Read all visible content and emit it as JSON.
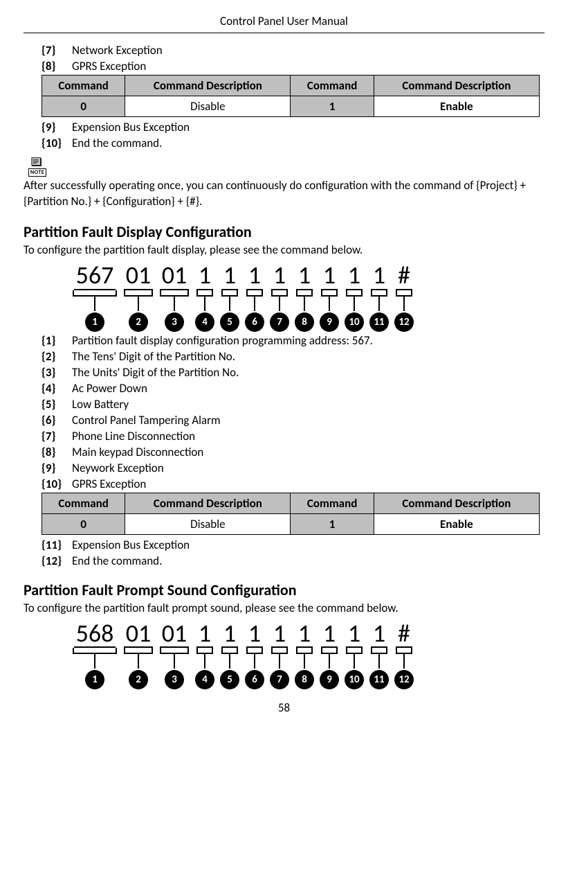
{
  "header_title": "Control Panel User Manual",
  "top_items": [
    {
      "n": "{7}",
      "t": "Network Exception"
    },
    {
      "n": "{8}",
      "t": "GPRS Exception"
    }
  ],
  "table1": {
    "h": [
      "Command",
      "Command Description",
      "Command",
      "Command Description"
    ],
    "r": [
      "0",
      "Disable",
      "1",
      "Enable"
    ]
  },
  "post_table1_items": [
    {
      "n": "{9}",
      "t": "Expension Bus Exception"
    },
    {
      "n": "{10}",
      "t": "End the command."
    }
  ],
  "note_label": "NOTE",
  "note_text": "After successfully operating once, you can continuously do configuration with the command of {Project} + {Partition No.} + {Configuration} + {#}.",
  "section1": {
    "heading": "Partition Fault Display Configuration",
    "intro": "To configure the partition fault display, please see the command below.",
    "digits": [
      "567",
      "01",
      "01",
      "1",
      "1",
      "1",
      "1",
      "1",
      "1",
      "1",
      "1",
      "#"
    ],
    "labels": [
      "1",
      "2",
      "3",
      "4",
      "5",
      "6",
      "7",
      "8",
      "9",
      "10",
      "11",
      "12"
    ],
    "items": [
      {
        "n": "{1}",
        "t": "Partition fault display configuration programming address: 567."
      },
      {
        "n": "{2}",
        "t": "The Tens' Digit of the Partition No."
      },
      {
        "n": "{3}",
        "t": "The Units' Digit of the Partition No."
      },
      {
        "n": "{4}",
        "t": "Ac Power Down"
      },
      {
        "n": "{5}",
        "t": "Low Battery"
      },
      {
        "n": "{6}",
        "t": "Control Panel Tampering Alarm"
      },
      {
        "n": "{7}",
        "t": "Phone Line Disconnection"
      },
      {
        "n": "{8}",
        "t": "Main keypad Disconnection"
      },
      {
        "n": "{9}",
        "t": "Neywork Exception"
      },
      {
        "n": "{10}",
        "t": "GPRS Exception"
      }
    ],
    "table": {
      "h": [
        "Command",
        "Command Description",
        "Command",
        "Command Description"
      ],
      "r": [
        "0",
        "Disable",
        "1",
        "Enable"
      ]
    },
    "post_items": [
      {
        "n": "{11}",
        "t": "Expension Bus Exception"
      },
      {
        "n": "{12}",
        "t": "End the command."
      }
    ]
  },
  "section2": {
    "heading": "Partition Fault Prompt Sound Configuration",
    "intro": "To configure the partition fault prompt sound, please see the command below.",
    "digits": [
      "568",
      "01",
      "01",
      "1",
      "1",
      "1",
      "1",
      "1",
      "1",
      "1",
      "1",
      "#"
    ],
    "labels": [
      "1",
      "2",
      "3",
      "4",
      "5",
      "6",
      "7",
      "8",
      "9",
      "10",
      "11",
      "12"
    ]
  },
  "page_number": "58",
  "chart_data": [
    {
      "type": "table",
      "title": "First command table",
      "headers": [
        "Command",
        "Command Description",
        "Command",
        "Command Description"
      ],
      "rows": [
        [
          "0",
          "Disable",
          "1",
          "Enable"
        ]
      ]
    },
    {
      "type": "diagram",
      "title": "Partition Fault Display command",
      "sequence": [
        "567",
        "01",
        "01",
        "1",
        "1",
        "1",
        "1",
        "1",
        "1",
        "1",
        "1",
        "#"
      ],
      "reference_labels": [
        1,
        2,
        3,
        4,
        5,
        6,
        7,
        8,
        9,
        10,
        11,
        12
      ]
    },
    {
      "type": "table",
      "title": "Partition Fault Display command table",
      "headers": [
        "Command",
        "Command Description",
        "Command",
        "Command Description"
      ],
      "rows": [
        [
          "0",
          "Disable",
          "1",
          "Enable"
        ]
      ]
    },
    {
      "type": "diagram",
      "title": "Partition Fault Prompt Sound command",
      "sequence": [
        "568",
        "01",
        "01",
        "1",
        "1",
        "1",
        "1",
        "1",
        "1",
        "1",
        "1",
        "#"
      ],
      "reference_labels": [
        1,
        2,
        3,
        4,
        5,
        6,
        7,
        8,
        9,
        10,
        11,
        12
      ]
    }
  ]
}
